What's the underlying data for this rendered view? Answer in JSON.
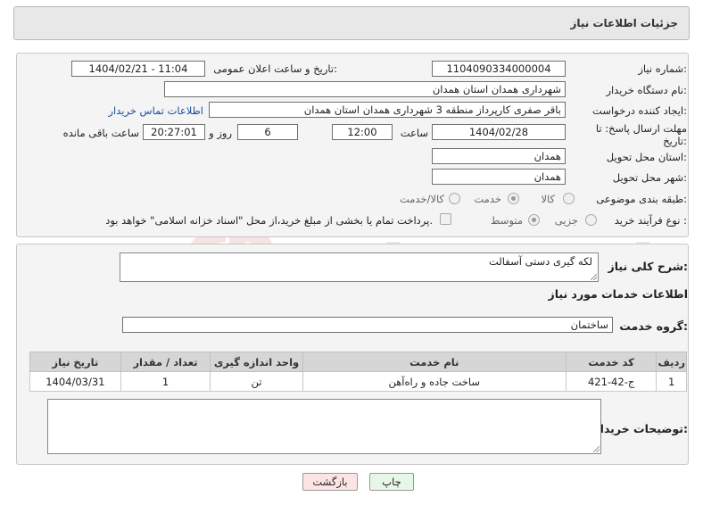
{
  "page": {
    "title": "جزئیات اطلاعات نیاز"
  },
  "fields": {
    "need_number_label": "شماره نیاز:",
    "need_number": "1104090334000004",
    "announce_label": "تاریخ و ساعت اعلان عمومی:",
    "announce_value": "1404/02/21 - 11:04",
    "buyer_org_label": "نام دستگاه خریدار:",
    "buyer_org": "شهرداری همدان استان همدان",
    "creator_label": "ایجاد کننده درخواست:",
    "creator": "باقر صفری کارپرداز منطقه 3 شهرداری همدان استان همدان",
    "contact_link": "اطلاعات تماس خریدار",
    "deadline_label_1": "مهلت ارسال پاسخ: تا",
    "deadline_label_2": "تاریخ:",
    "deadline_date": "1404/02/28",
    "time_label": "ساعت",
    "deadline_time": "12:00",
    "days": "6",
    "days_label": "روز و",
    "remaining_time": "20:27:01",
    "remaining_label": "ساعت باقی مانده",
    "province_label": "استان محل تحویل:",
    "province": "همدان",
    "city_label": "شهر محل تحویل:",
    "city": "همدان",
    "category_label": "طبقه بندی موضوعی:",
    "category_options": [
      "کالا",
      "خدمت",
      "کالا/خدمت"
    ],
    "process_label": "نوع فرآیند خرید :",
    "process_options": [
      "جزیی",
      "متوسط"
    ],
    "payment_note": "پرداخت تمام یا بخشی از مبلغ خرید،از محل \"اسناد خزانه اسلامی\" خواهد بود."
  },
  "summary": {
    "description_label": "شرح کلی نیاز:",
    "description": "لکه گیری دستی آسفالت",
    "services_title": "اطلاعات خدمات مورد نیاز",
    "service_group_label": "گروه خدمت:",
    "service_group": "ساختمان"
  },
  "table": {
    "headers": [
      "ردیف",
      "کد خدمت",
      "نام خدمت",
      "واحد اندازه گیری",
      "تعداد / مقدار",
      "تاریخ نیاز"
    ],
    "rows": [
      [
        "1",
        "ج-42-421",
        "ساخت جاده و راه‌آهن",
        "تن",
        "1",
        "1404/03/31"
      ]
    ]
  },
  "buyer_notes_label": "توضیحات خریدار:",
  "buttons": {
    "print": "چاپ",
    "back": "بازگشت"
  },
  "watermark": "AriaTender.net",
  "colors": {
    "link": "#1a4fa0",
    "back_button": "#fde4e4",
    "print_button": "#e6f7e6",
    "header_bg": "#e8e8e8"
  }
}
